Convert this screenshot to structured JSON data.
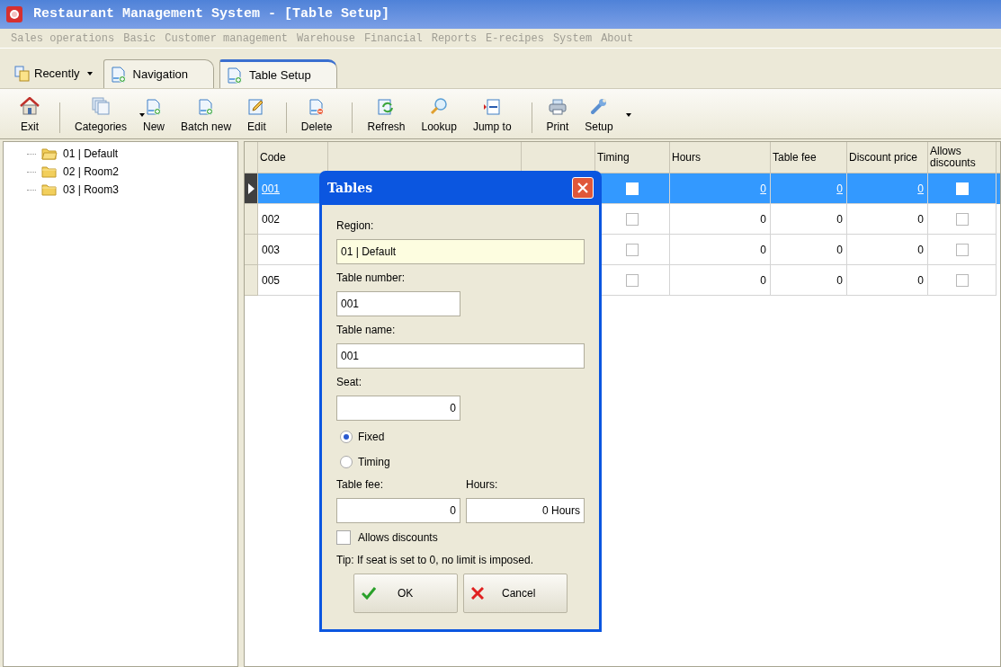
{
  "window": {
    "title": "Restaurant Management System - [Table Setup]"
  },
  "menu": [
    {
      "label": "Sales operations"
    },
    {
      "label": "Basic"
    },
    {
      "label": "Customer management"
    },
    {
      "label": "Warehouse"
    },
    {
      "label": "Financial"
    },
    {
      "label": "Reports"
    },
    {
      "label": "E-recipes"
    },
    {
      "label": "System"
    },
    {
      "label": "About"
    }
  ],
  "recent": {
    "label": "Recently"
  },
  "tabs": [
    {
      "label": "Navigation",
      "selected": false
    },
    {
      "label": "Table Setup",
      "selected": true
    }
  ],
  "toolbar": [
    {
      "kind": "home",
      "label": "Exit"
    },
    {
      "kind": "sep"
    },
    {
      "kind": "stack",
      "label": "Categories",
      "dropdown": true
    },
    {
      "kind": "new",
      "label": "New"
    },
    {
      "kind": "new",
      "label": "Batch new"
    },
    {
      "kind": "edit",
      "label": "Edit"
    },
    {
      "kind": "sep"
    },
    {
      "kind": "delete",
      "label": "Delete"
    },
    {
      "kind": "sep"
    },
    {
      "kind": "refresh",
      "label": "Refresh"
    },
    {
      "kind": "lookup",
      "label": "Lookup"
    },
    {
      "kind": "jump",
      "label": "Jump to"
    },
    {
      "kind": "sep"
    },
    {
      "kind": "print",
      "label": "Print"
    },
    {
      "kind": "setup",
      "label": "Setup",
      "dropdown": true
    }
  ],
  "tree": [
    {
      "label": "01 | Default",
      "expanded": true
    },
    {
      "label": "02 | Room2",
      "expanded": false
    },
    {
      "label": "03 | Room3",
      "expanded": false
    }
  ],
  "table": {
    "columns": [
      "Code",
      "",
      "",
      "Timing",
      "Hours",
      "Table fee",
      "Discount price",
      "Allows discounts"
    ],
    "rows": [
      {
        "code": "001",
        "timing": false,
        "hours": "0",
        "fee": "0",
        "discount": "0",
        "allows": false,
        "selected": true
      },
      {
        "code": "002",
        "timing": false,
        "hours": "0",
        "fee": "0",
        "discount": "0",
        "allows": false,
        "selected": false
      },
      {
        "code": "003",
        "timing": false,
        "hours": "0",
        "fee": "0",
        "discount": "0",
        "allows": false,
        "selected": false
      },
      {
        "code": "005",
        "timing": false,
        "hours": "0",
        "fee": "0",
        "discount": "0",
        "allows": false,
        "selected": false
      }
    ]
  },
  "dialog": {
    "title": "Tables",
    "region_label": "Region:",
    "region": "01 | Default",
    "number_label": "Table number:",
    "number": "001",
    "name_label": "Table name:",
    "name": "001",
    "seat_label": "Seat:",
    "seat": "0",
    "modes": [
      {
        "label": "Fixed",
        "selected": true
      },
      {
        "label": "Timing",
        "selected": false
      }
    ],
    "fee_label": "Table fee:",
    "fee": "0",
    "hours_label": "Hours:",
    "hours": "0 Hours",
    "allows": {
      "label": "Allows discounts",
      "checked": false
    },
    "tip": "Tip: If seat is set to 0, no limit is imposed.",
    "ok": "OK",
    "cancel": "Cancel"
  }
}
